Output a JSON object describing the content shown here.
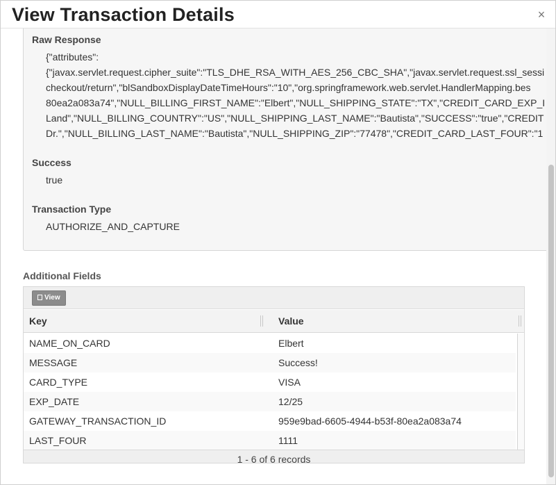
{
  "modal": {
    "title": "View Transaction Details",
    "close_label": "×"
  },
  "details": {
    "raw_response_label": "Raw Response",
    "raw_response_lines": [
      "{\"attributes\":",
      "{\"javax.servlet.request.cipher_suite\":\"TLS_DHE_RSA_WITH_AES_256_CBC_SHA\",\"javax.servlet.request.ssl_sessi",
      "checkout/return\",\"blSandboxDisplayDateTimeHours\":\"10\",\"org.springframework.web.servlet.HandlerMapping.bes",
      "80ea2a083a74\",\"NULL_BILLING_FIRST_NAME\":\"Elbert\",\"NULL_SHIPPING_STATE\":\"TX\",\"CREDIT_CARD_EXP_I",
      "Land\",\"NULL_BILLING_COUNTRY\":\"US\",\"NULL_SHIPPING_LAST_NAME\":\"Bautista\",\"SUCCESS\":\"true\",\"CREDIT",
      "Dr.\",\"NULL_BILLING_LAST_NAME\":\"Bautista\",\"NULL_SHIPPING_ZIP\":\"77478\",\"CREDIT_CARD_LAST_FOUR\":\"1"
    ],
    "success_label": "Success",
    "success_value": "true",
    "transaction_type_label": "Transaction Type",
    "transaction_type_value": "AUTHORIZE_AND_CAPTURE"
  },
  "additional_fields": {
    "title": "Additional Fields",
    "view_button_label": "View",
    "columns": [
      "Key",
      "Value"
    ],
    "rows": [
      {
        "key": "NAME_ON_CARD",
        "value": "Elbert"
      },
      {
        "key": "MESSAGE",
        "value": "Success!"
      },
      {
        "key": "CARD_TYPE",
        "value": "VISA"
      },
      {
        "key": "EXP_DATE",
        "value": "12/25"
      },
      {
        "key": "GATEWAY_TRANSACTION_ID",
        "value": "959e9bad-6605-4944-b53f-80ea2a083a74"
      },
      {
        "key": "LAST_FOUR",
        "value": "1111"
      }
    ],
    "footer": "1 - 6 of 6 records"
  },
  "icons": {
    "view_icon": "book-icon",
    "close_icon": "close-icon"
  }
}
